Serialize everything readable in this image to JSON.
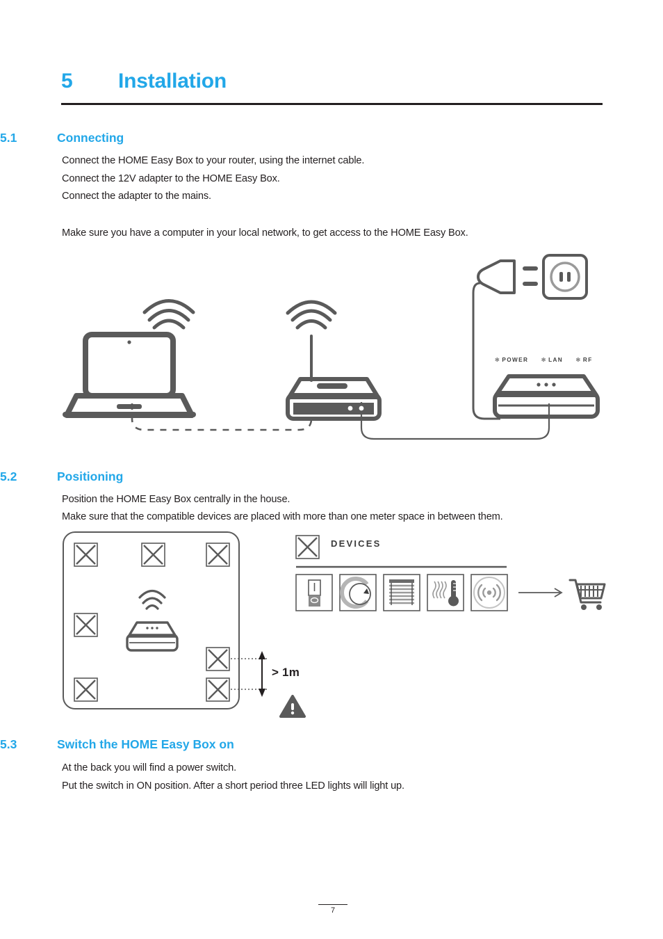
{
  "document": {
    "chapter_number": "5",
    "chapter_title": "Installation",
    "page_number": "7"
  },
  "sections": [
    {
      "number": "5.1",
      "title": "Connecting",
      "lines": [
        "Connect the HOME Easy Box to your router, using the internet cable.",
        "Connect the 12V adapter to the HOME Easy Box.",
        "Connect the adapter to the mains.",
        "Make sure you have a computer in your local network, to get access to the HOME Easy Box."
      ]
    },
    {
      "number": "5.2",
      "title": "Positioning",
      "lines": [
        "Position the HOME Easy Box centrally in the house.",
        "Make sure that the compatible devices are placed with more than one meter space in between them."
      ]
    },
    {
      "number": "5.3",
      "title": "Switch the HOME Easy Box on",
      "lines": [
        "At the back you will find a power switch.",
        "Put the switch in ON position. After a short period three LED lights will light up."
      ]
    }
  ],
  "connection_diagram": {
    "led_labels": [
      "POWER",
      "LAN",
      "RF"
    ],
    "led_glyph": "✻",
    "nodes": [
      {
        "name": "laptop",
        "icon": "laptop-icon"
      },
      {
        "name": "router",
        "icon": "router-icon"
      },
      {
        "name": "home-easy-box",
        "icon": "home-easy-box-icon"
      },
      {
        "name": "power-plug",
        "icon": "power-plug-icon"
      },
      {
        "name": "wall-socket",
        "icon": "wall-socket-icon"
      }
    ]
  },
  "positioning_diagram": {
    "marker_count": 7,
    "center_device": "home-easy-box-icon",
    "distance_label": "> 1m",
    "warning_icon": "warning-triangle-icon"
  },
  "devices_panel": {
    "heading": "DEVICES",
    "marker_icon": "x-marker-icon",
    "devices": [
      {
        "name": "switch",
        "icon": "wall-switch-icon"
      },
      {
        "name": "dimmer",
        "icon": "dimmer-knob-icon"
      },
      {
        "name": "blinds",
        "icon": "blinds-icon"
      },
      {
        "name": "thermostat",
        "icon": "thermometer-icon"
      },
      {
        "name": "sensor",
        "icon": "motion-sensor-icon"
      }
    ],
    "arrow_icon": "arrow-right-icon",
    "cart_icon": "shopping-cart-icon"
  },
  "colors": {
    "accent": "#22a7e8",
    "text": "#231f20",
    "line_art": "#5a5a5a",
    "line_art_light": "#9a9a9a"
  }
}
